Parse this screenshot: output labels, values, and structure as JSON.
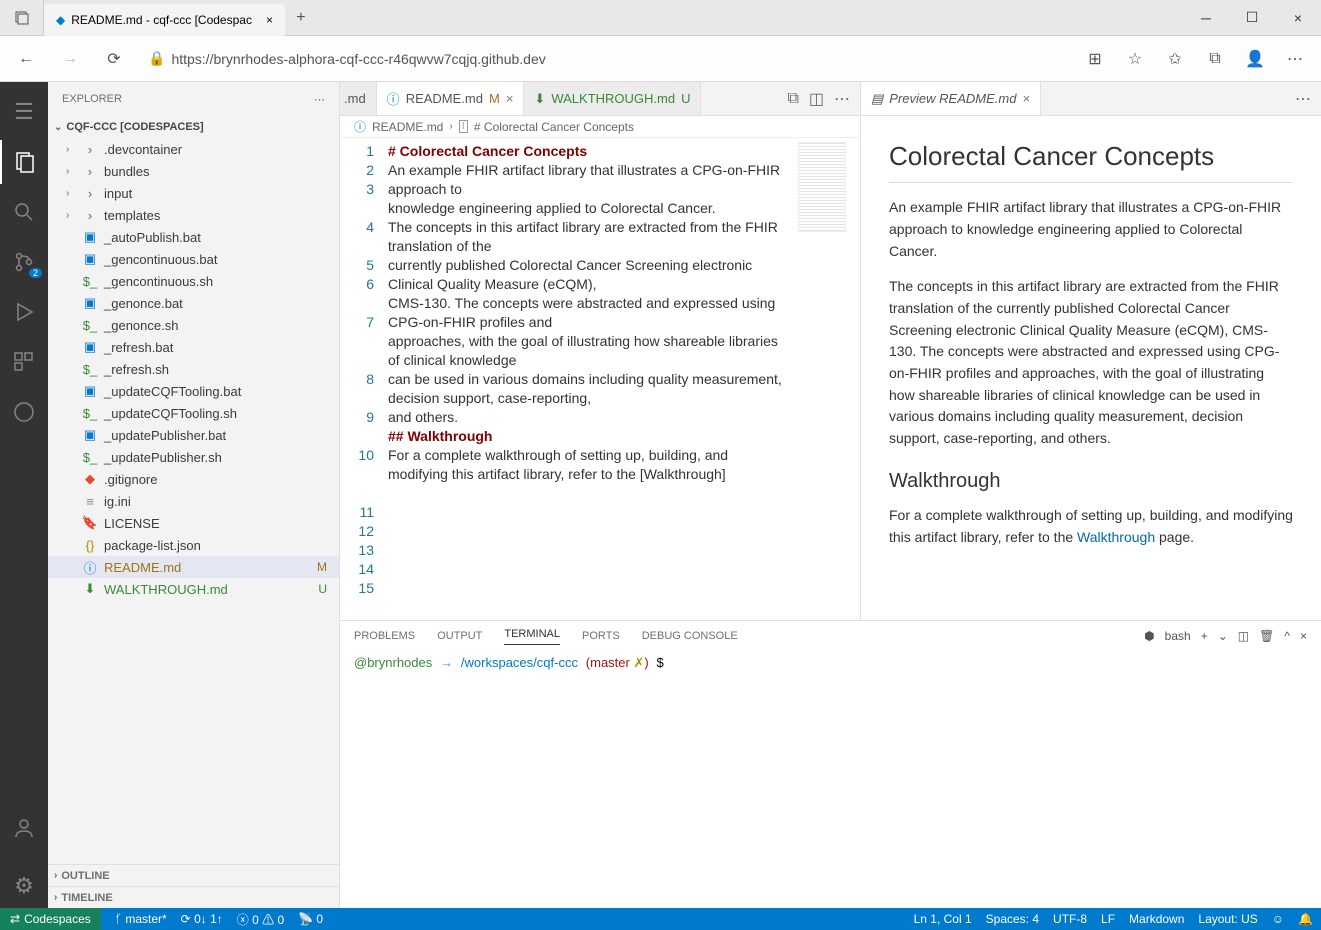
{
  "browser": {
    "tabTitle": "README.md - cqf-ccc [Codespac",
    "url": "https://brynrhodes-alphora-cqf-ccc-r46qwvw7cqjq.github.dev"
  },
  "activityBadge": "2",
  "sidebar": {
    "title": "EXPLORER",
    "workspace": "CQF-CCC [CODESPACES]",
    "outline": "OUTLINE",
    "timeline": "TIMELINE",
    "files": [
      {
        "name": ".devcontainer",
        "type": "folder"
      },
      {
        "name": "bundles",
        "type": "folder"
      },
      {
        "name": "input",
        "type": "folder"
      },
      {
        "name": "templates",
        "type": "folder"
      },
      {
        "name": "_autoPublish.bat",
        "type": "bat"
      },
      {
        "name": "_gencontinuous.bat",
        "type": "bat"
      },
      {
        "name": "_gencontinuous.sh",
        "type": "sh"
      },
      {
        "name": "_genonce.bat",
        "type": "bat"
      },
      {
        "name": "_genonce.sh",
        "type": "sh"
      },
      {
        "name": "_refresh.bat",
        "type": "bat"
      },
      {
        "name": "_refresh.sh",
        "type": "sh"
      },
      {
        "name": "_updateCQFTooling.bat",
        "type": "bat"
      },
      {
        "name": "_updateCQFTooling.sh",
        "type": "sh"
      },
      {
        "name": "_updatePublisher.bat",
        "type": "bat"
      },
      {
        "name": "_updatePublisher.sh",
        "type": "sh"
      },
      {
        "name": ".gitignore",
        "type": "git"
      },
      {
        "name": "ig.ini",
        "type": "ini"
      },
      {
        "name": "LICENSE",
        "type": "lic"
      },
      {
        "name": "package-list.json",
        "type": "json"
      },
      {
        "name": "README.md",
        "type": "md",
        "status": "M",
        "selected": true
      },
      {
        "name": "WALKTHROUGH.md",
        "type": "md2",
        "status": "U"
      }
    ]
  },
  "tabs": {
    "hidden": ".md",
    "t1": "README.md",
    "t1s": "M",
    "t2": "WALKTHROUGH.md",
    "t2s": "U",
    "preview": "Preview README.md"
  },
  "breadcrumb": {
    "file": "README.md",
    "section": "# Colorectal Cancer Concepts"
  },
  "editor": {
    "lines": [
      {
        "n": "1",
        "cls": "h1",
        "t": "# Colorectal Cancer Concepts"
      },
      {
        "n": "2",
        "t": ""
      },
      {
        "n": "3",
        "t": "An example FHIR artifact library that illustrates a CPG-on-FHIR approach to"
      },
      {
        "n": "4",
        "t": "knowledge engineering applied to Colorectal Cancer."
      },
      {
        "n": "5",
        "t": ""
      },
      {
        "n": "6",
        "t": "The concepts in this artifact library are extracted from the FHIR translation of the"
      },
      {
        "n": "7",
        "t": "currently published Colorectal Cancer Screening electronic Clinical Quality Measure (eCQM),"
      },
      {
        "n": "8",
        "t": "CMS-130. The concepts were abstracted and expressed using CPG-on-FHIR profiles and"
      },
      {
        "n": "9",
        "t": "approaches, with the goal of illustrating how shareable libraries of clinical knowledge"
      },
      {
        "n": "10",
        "t": "can be used in various domains including quality measurement, decision support, case-reporting,"
      },
      {
        "n": "11",
        "t": "and others."
      },
      {
        "n": "12",
        "t": ""
      },
      {
        "n": "13",
        "cls": "h2",
        "t": "## Walkthrough"
      },
      {
        "n": "14",
        "t": ""
      },
      {
        "n": "15",
        "t": "For a complete walkthrough of setting up, building, and modifying this artifact library, refer to the [Walkthrough]"
      }
    ]
  },
  "preview": {
    "h1": "Colorectal Cancer Concepts",
    "p1": "An example FHIR artifact library that illustrates a CPG-on-FHIR approach to knowledge engineering applied to Colorectal Cancer.",
    "p2": "The concepts in this artifact library are extracted from the FHIR translation of the currently published Colorectal Cancer Screening electronic Clinical Quality Measure (eCQM), CMS-130. The concepts were abstracted and expressed using CPG-on-FHIR profiles and approaches, with the goal of illustrating how shareable libraries of clinical knowledge can be used in various domains including quality measurement, decision support, case-reporting, and others.",
    "h2": "Walkthrough",
    "p3a": "For a complete walkthrough of setting up, building, and modifying this artifact library, refer to the ",
    "p3link": "Walkthrough",
    "p3b": " page."
  },
  "panel": {
    "tabs": [
      "PROBLEMS",
      "OUTPUT",
      "TERMINAL",
      "PORTS",
      "DEBUG CONSOLE"
    ],
    "active": 2,
    "shell": "bash",
    "prompt": {
      "user": "@brynrhodes",
      "arrow": "→",
      "path": "/workspaces/cqf-ccc",
      "branchOpen": "(",
      "branch": "master ",
      "yx": "✗",
      "branchClose": ")",
      "dollar": " $"
    }
  },
  "status": {
    "remote": "Codespaces",
    "branch": "master*",
    "sync": "0↓ 1↑",
    "errs": "0",
    "warns": "0",
    "ports": "0",
    "ln": "Ln 1, Col 1",
    "spaces": "Spaces: 4",
    "enc": "UTF-8",
    "eol": "LF",
    "lang": "Markdown",
    "layout": "Layout: US"
  }
}
